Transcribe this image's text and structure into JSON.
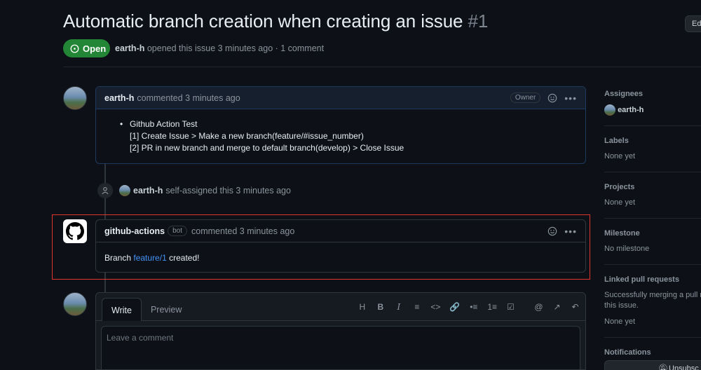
{
  "header": {
    "title": "Automatic branch creation when creating an issue",
    "issue_number": "#1",
    "edit_label": "Ed",
    "state_label": "Open",
    "author": "earth-h",
    "meta_text": "opened this issue 3 minutes ago · 1 comment"
  },
  "comments": [
    {
      "author": "earth-h",
      "time": "commented 3 minutes ago",
      "badge": "Owner",
      "body": {
        "bullet": "Github Action Test",
        "line1": "[1] Create Issue > Make a new branch(feature/#issue_number)",
        "line2": "[2] PR in new branch and merge to default branch(develop) > Close Issue"
      }
    },
    {
      "author": "github-actions",
      "badge": "bot",
      "time": "commented 3 minutes ago",
      "body_prefix": "Branch",
      "body_link": "feature/1",
      "body_suffix": "created!"
    }
  ],
  "event": {
    "actor": "earth-h",
    "text": "self-assigned this 3 minutes ago"
  },
  "editor": {
    "tab_write": "Write",
    "tab_preview": "Preview",
    "placeholder": "Leave a comment",
    "toolbar": [
      "H",
      "B",
      "I",
      "≡",
      "<>",
      "🔗",
      "•≡",
      "1≡",
      "☑",
      "@",
      "↗",
      "↶"
    ]
  },
  "sidebar": {
    "assignees": {
      "title": "Assignees",
      "value": "earth-h"
    },
    "labels": {
      "title": "Labels",
      "value": "None yet"
    },
    "projects": {
      "title": "Projects",
      "value": "None yet"
    },
    "milestone": {
      "title": "Milestone",
      "value": "No milestone"
    },
    "linked": {
      "title": "Linked pull requests",
      "desc1": "Successfully merging a pull re",
      "desc2": "this issue.",
      "value": "None yet"
    },
    "notifications": {
      "title": "Notifications",
      "button": "Unsubsc"
    }
  },
  "colors": {
    "open_green": "#238636",
    "link_blue": "#4493f8",
    "highlight_red": "#e0362b"
  }
}
